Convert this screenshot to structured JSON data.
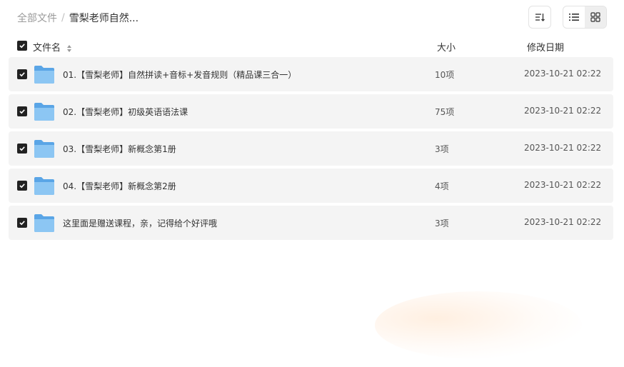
{
  "breadcrumb": {
    "root": "全部文件",
    "separator": "/",
    "current": "雪梨老师自然..."
  },
  "header": {
    "name": "文件名",
    "size": "大小",
    "date": "修改日期"
  },
  "files": [
    {
      "name": "01.【雪梨老师】自然拼读+音标+发音规则（精品课三合一）",
      "size": "10项",
      "date": "2023-10-21 02:22"
    },
    {
      "name": "02.【雪梨老师】初级英语语法课",
      "size": "75项",
      "date": "2023-10-21 02:22"
    },
    {
      "name": "03.【雪梨老师】新概念第1册",
      "size": "3项",
      "date": "2023-10-21 02:22"
    },
    {
      "name": "04.【雪梨老师】新概念第2册",
      "size": "4项",
      "date": "2023-10-21 02:22"
    },
    {
      "name": "这里面是赠送课程，亲，记得给个好评哦",
      "size": "3项",
      "date": "2023-10-21 02:22"
    }
  ],
  "icons": {
    "folder": "folder-icon",
    "check": "check-icon",
    "sort": "sort-icon",
    "list_view": "list-view-icon",
    "grid_view": "grid-view-icon"
  },
  "colors": {
    "folder": "#6fb3ea",
    "checkbox": "#222222",
    "row_bg": "#f4f4f4"
  },
  "view_mode": "list"
}
